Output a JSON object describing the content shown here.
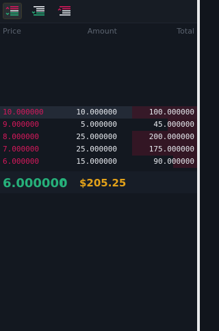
{
  "toolbar": {
    "buttons": [
      {
        "icon": "orderbook-both-icon",
        "active": true
      },
      {
        "icon": "orderbook-bids-icon",
        "active": false
      },
      {
        "icon": "orderbook-asks-icon",
        "active": false
      }
    ]
  },
  "columns": {
    "price": "Price",
    "amount": "Amount",
    "total": "Total"
  },
  "asks": [
    {
      "price": "10.000000",
      "amount": "10.000000",
      "total": "100.000000",
      "depth": 0.33
    },
    {
      "price": "9.000000",
      "amount": "5.000000",
      "total": "45.000000",
      "depth": 0.15
    },
    {
      "price": "8.000000",
      "amount": "25.000000",
      "total": "200.000000",
      "depth": 0.33
    },
    {
      "price": "7.000000",
      "amount": "25.000000",
      "total": "175.000000",
      "depth": 0.33
    },
    {
      "price": "6.000000",
      "amount": "15.000000",
      "total": "90.000000",
      "depth": 0.12
    }
  ],
  "summary": {
    "last_price": "6.000000",
    "direction": "↑",
    "usd_price": "$205.25"
  },
  "colors": {
    "ask": "#d6185c",
    "bid": "#26b07a",
    "usd": "#e3a21a"
  }
}
